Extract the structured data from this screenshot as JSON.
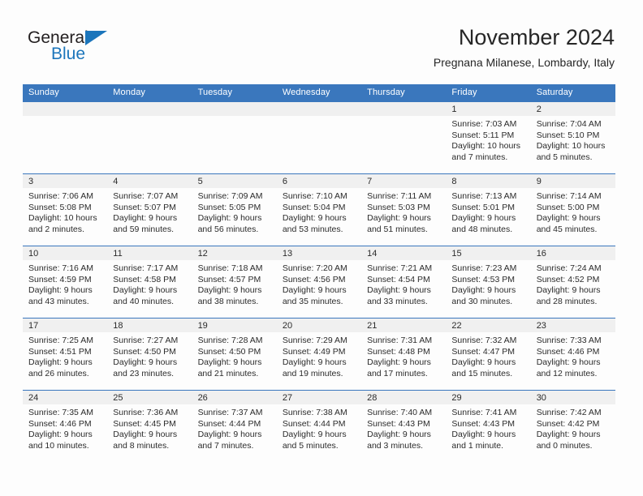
{
  "logo": {
    "word_top": "General",
    "word_bottom": "Blue",
    "triangle_icon": "blue-triangle-icon",
    "colors": {
      "dark": "#231f20",
      "blue": "#1b75bb"
    }
  },
  "header": {
    "title": "November 2024",
    "subtitle": "Pregnana Milanese, Lombardy, Italy"
  },
  "theme": {
    "header_blue": "#3a77bd",
    "daynum_band": "#f0f0f0",
    "page_background": "#fdfdfd",
    "text": "#2b2b2b"
  },
  "weekdays": [
    "Sunday",
    "Monday",
    "Tuesday",
    "Wednesday",
    "Thursday",
    "Friday",
    "Saturday"
  ],
  "weeks": [
    [
      {
        "day": "",
        "empty": true,
        "sunrise": "",
        "sunset": "",
        "daylight_1": "",
        "daylight_2": ""
      },
      {
        "day": "",
        "empty": true,
        "sunrise": "",
        "sunset": "",
        "daylight_1": "",
        "daylight_2": ""
      },
      {
        "day": "",
        "empty": true,
        "sunrise": "",
        "sunset": "",
        "daylight_1": "",
        "daylight_2": ""
      },
      {
        "day": "",
        "empty": true,
        "sunrise": "",
        "sunset": "",
        "daylight_1": "",
        "daylight_2": ""
      },
      {
        "day": "",
        "empty": true,
        "sunrise": "",
        "sunset": "",
        "daylight_1": "",
        "daylight_2": ""
      },
      {
        "day": "1",
        "empty": false,
        "sunrise": "Sunrise: 7:03 AM",
        "sunset": "Sunset: 5:11 PM",
        "daylight_1": "Daylight: 10 hours",
        "daylight_2": "and 7 minutes."
      },
      {
        "day": "2",
        "empty": false,
        "sunrise": "Sunrise: 7:04 AM",
        "sunset": "Sunset: 5:10 PM",
        "daylight_1": "Daylight: 10 hours",
        "daylight_2": "and 5 minutes."
      }
    ],
    [
      {
        "day": "3",
        "empty": false,
        "sunrise": "Sunrise: 7:06 AM",
        "sunset": "Sunset: 5:08 PM",
        "daylight_1": "Daylight: 10 hours",
        "daylight_2": "and 2 minutes."
      },
      {
        "day": "4",
        "empty": false,
        "sunrise": "Sunrise: 7:07 AM",
        "sunset": "Sunset: 5:07 PM",
        "daylight_1": "Daylight: 9 hours",
        "daylight_2": "and 59 minutes."
      },
      {
        "day": "5",
        "empty": false,
        "sunrise": "Sunrise: 7:09 AM",
        "sunset": "Sunset: 5:05 PM",
        "daylight_1": "Daylight: 9 hours",
        "daylight_2": "and 56 minutes."
      },
      {
        "day": "6",
        "empty": false,
        "sunrise": "Sunrise: 7:10 AM",
        "sunset": "Sunset: 5:04 PM",
        "daylight_1": "Daylight: 9 hours",
        "daylight_2": "and 53 minutes."
      },
      {
        "day": "7",
        "empty": false,
        "sunrise": "Sunrise: 7:11 AM",
        "sunset": "Sunset: 5:03 PM",
        "daylight_1": "Daylight: 9 hours",
        "daylight_2": "and 51 minutes."
      },
      {
        "day": "8",
        "empty": false,
        "sunrise": "Sunrise: 7:13 AM",
        "sunset": "Sunset: 5:01 PM",
        "daylight_1": "Daylight: 9 hours",
        "daylight_2": "and 48 minutes."
      },
      {
        "day": "9",
        "empty": false,
        "sunrise": "Sunrise: 7:14 AM",
        "sunset": "Sunset: 5:00 PM",
        "daylight_1": "Daylight: 9 hours",
        "daylight_2": "and 45 minutes."
      }
    ],
    [
      {
        "day": "10",
        "empty": false,
        "sunrise": "Sunrise: 7:16 AM",
        "sunset": "Sunset: 4:59 PM",
        "daylight_1": "Daylight: 9 hours",
        "daylight_2": "and 43 minutes."
      },
      {
        "day": "11",
        "empty": false,
        "sunrise": "Sunrise: 7:17 AM",
        "sunset": "Sunset: 4:58 PM",
        "daylight_1": "Daylight: 9 hours",
        "daylight_2": "and 40 minutes."
      },
      {
        "day": "12",
        "empty": false,
        "sunrise": "Sunrise: 7:18 AM",
        "sunset": "Sunset: 4:57 PM",
        "daylight_1": "Daylight: 9 hours",
        "daylight_2": "and 38 minutes."
      },
      {
        "day": "13",
        "empty": false,
        "sunrise": "Sunrise: 7:20 AM",
        "sunset": "Sunset: 4:56 PM",
        "daylight_1": "Daylight: 9 hours",
        "daylight_2": "and 35 minutes."
      },
      {
        "day": "14",
        "empty": false,
        "sunrise": "Sunrise: 7:21 AM",
        "sunset": "Sunset: 4:54 PM",
        "daylight_1": "Daylight: 9 hours",
        "daylight_2": "and 33 minutes."
      },
      {
        "day": "15",
        "empty": false,
        "sunrise": "Sunrise: 7:23 AM",
        "sunset": "Sunset: 4:53 PM",
        "daylight_1": "Daylight: 9 hours",
        "daylight_2": "and 30 minutes."
      },
      {
        "day": "16",
        "empty": false,
        "sunrise": "Sunrise: 7:24 AM",
        "sunset": "Sunset: 4:52 PM",
        "daylight_1": "Daylight: 9 hours",
        "daylight_2": "and 28 minutes."
      }
    ],
    [
      {
        "day": "17",
        "empty": false,
        "sunrise": "Sunrise: 7:25 AM",
        "sunset": "Sunset: 4:51 PM",
        "daylight_1": "Daylight: 9 hours",
        "daylight_2": "and 26 minutes."
      },
      {
        "day": "18",
        "empty": false,
        "sunrise": "Sunrise: 7:27 AM",
        "sunset": "Sunset: 4:50 PM",
        "daylight_1": "Daylight: 9 hours",
        "daylight_2": "and 23 minutes."
      },
      {
        "day": "19",
        "empty": false,
        "sunrise": "Sunrise: 7:28 AM",
        "sunset": "Sunset: 4:50 PM",
        "daylight_1": "Daylight: 9 hours",
        "daylight_2": "and 21 minutes."
      },
      {
        "day": "20",
        "empty": false,
        "sunrise": "Sunrise: 7:29 AM",
        "sunset": "Sunset: 4:49 PM",
        "daylight_1": "Daylight: 9 hours",
        "daylight_2": "and 19 minutes."
      },
      {
        "day": "21",
        "empty": false,
        "sunrise": "Sunrise: 7:31 AM",
        "sunset": "Sunset: 4:48 PM",
        "daylight_1": "Daylight: 9 hours",
        "daylight_2": "and 17 minutes."
      },
      {
        "day": "22",
        "empty": false,
        "sunrise": "Sunrise: 7:32 AM",
        "sunset": "Sunset: 4:47 PM",
        "daylight_1": "Daylight: 9 hours",
        "daylight_2": "and 15 minutes."
      },
      {
        "day": "23",
        "empty": false,
        "sunrise": "Sunrise: 7:33 AM",
        "sunset": "Sunset: 4:46 PM",
        "daylight_1": "Daylight: 9 hours",
        "daylight_2": "and 12 minutes."
      }
    ],
    [
      {
        "day": "24",
        "empty": false,
        "sunrise": "Sunrise: 7:35 AM",
        "sunset": "Sunset: 4:46 PM",
        "daylight_1": "Daylight: 9 hours",
        "daylight_2": "and 10 minutes."
      },
      {
        "day": "25",
        "empty": false,
        "sunrise": "Sunrise: 7:36 AM",
        "sunset": "Sunset: 4:45 PM",
        "daylight_1": "Daylight: 9 hours",
        "daylight_2": "and 8 minutes."
      },
      {
        "day": "26",
        "empty": false,
        "sunrise": "Sunrise: 7:37 AM",
        "sunset": "Sunset: 4:44 PM",
        "daylight_1": "Daylight: 9 hours",
        "daylight_2": "and 7 minutes."
      },
      {
        "day": "27",
        "empty": false,
        "sunrise": "Sunrise: 7:38 AM",
        "sunset": "Sunset: 4:44 PM",
        "daylight_1": "Daylight: 9 hours",
        "daylight_2": "and 5 minutes."
      },
      {
        "day": "28",
        "empty": false,
        "sunrise": "Sunrise: 7:40 AM",
        "sunset": "Sunset: 4:43 PM",
        "daylight_1": "Daylight: 9 hours",
        "daylight_2": "and 3 minutes."
      },
      {
        "day": "29",
        "empty": false,
        "sunrise": "Sunrise: 7:41 AM",
        "sunset": "Sunset: 4:43 PM",
        "daylight_1": "Daylight: 9 hours",
        "daylight_2": "and 1 minute."
      },
      {
        "day": "30",
        "empty": false,
        "sunrise": "Sunrise: 7:42 AM",
        "sunset": "Sunset: 4:42 PM",
        "daylight_1": "Daylight: 9 hours",
        "daylight_2": "and 0 minutes."
      }
    ]
  ]
}
